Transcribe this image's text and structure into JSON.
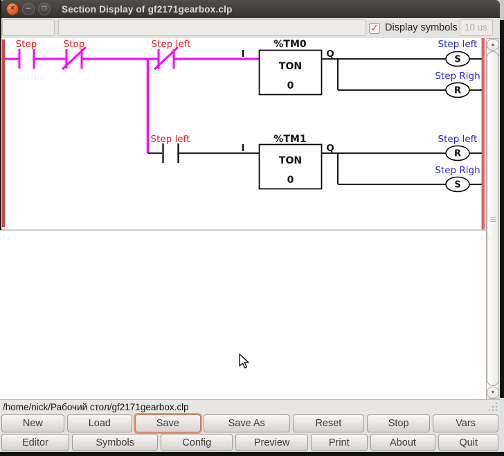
{
  "window": {
    "title": "Section Display of gf2171gearbox.clp"
  },
  "icons": {
    "close": "✕",
    "minimize": "–",
    "maximize": "❐",
    "check": "✓",
    "scroll_up": "▲",
    "scroll_down": "▼"
  },
  "toolbar": {
    "section_field_value": "",
    "comment_field_value": "",
    "display_symbols_label": "Display symbols",
    "display_symbols_checked": true,
    "time_base_value": "10 us"
  },
  "ladder": {
    "rung1": {
      "contacts": [
        {
          "label": "Step",
          "type": "normally-open"
        },
        {
          "label": "Stop",
          "type": "normally-closed"
        },
        {
          "label": "Step left",
          "type": "normally-closed"
        }
      ],
      "input_pin": "I",
      "timer": {
        "name": "%TM0",
        "function": "TON",
        "value": "0"
      },
      "output_pin": "Q",
      "coil1": {
        "label": "Step left",
        "op": "S"
      },
      "coil2": {
        "label": "Step Righ",
        "op": "R"
      }
    },
    "rung2": {
      "contact": {
        "label": "Step left",
        "type": "normally-open"
      },
      "input_pin": "I",
      "timer": {
        "name": "%TM1",
        "function": "TON",
        "value": "0"
      },
      "output_pin": "Q",
      "coil1": {
        "label": "Step left",
        "op": "R"
      },
      "coil2": {
        "label": "Step Righ",
        "op": "S"
      }
    }
  },
  "statusbar": {
    "path": "/home/nick/Рабочий стол/gf2171gearbox.clp"
  },
  "buttons": {
    "row1": [
      "New",
      "Load",
      "Save",
      "Save As",
      "Reset",
      "Stop",
      "Vars"
    ],
    "row2": [
      "Editor",
      "Symbols",
      "Config",
      "Preview",
      "Print",
      "About",
      "Quit"
    ],
    "focused": "Save"
  },
  "colors": {
    "wire_active": "#ff00ff",
    "wire_inactive": "#000000",
    "label_red": "#e81616",
    "label_blue": "#2727d8",
    "left_rail": "#d04545",
    "right_rail": "#e56060",
    "focus_ring": "#ef9273",
    "check": "#c83d10",
    "titlebar": "#3a3934"
  }
}
